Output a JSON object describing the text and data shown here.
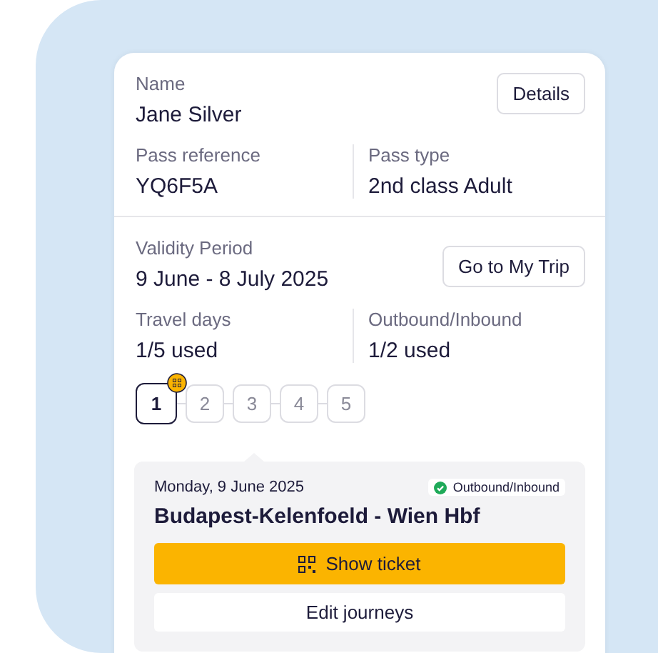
{
  "pass": {
    "name_label": "Name",
    "name": "Jane Silver",
    "details_button": "Details",
    "reference_label": "Pass reference",
    "reference": "YQ6F5A",
    "type_label": "Pass type",
    "type": "2nd class Adult"
  },
  "validity": {
    "label": "Validity Period",
    "value": "9 June - 8 July 2025",
    "trip_button": "Go to My Trip",
    "travel_days_label": "Travel days",
    "travel_days": "1/5 used",
    "outbound_label": "Outbound/Inbound",
    "outbound": "1/2 used"
  },
  "days": [
    {
      "label": "1",
      "selected": true,
      "ticket": true
    },
    {
      "label": "2",
      "selected": false,
      "ticket": false
    },
    {
      "label": "3",
      "selected": false,
      "ticket": false
    },
    {
      "label": "4",
      "selected": false,
      "ticket": false
    },
    {
      "label": "5",
      "selected": false,
      "ticket": false
    }
  ],
  "journey": {
    "date": "Monday, 9 June 2025",
    "status": "Outbound/Inbound",
    "route": "Budapest-Kelenfoeld - Wien Hbf",
    "show_ticket": "Show ticket",
    "edit": "Edit journeys"
  }
}
